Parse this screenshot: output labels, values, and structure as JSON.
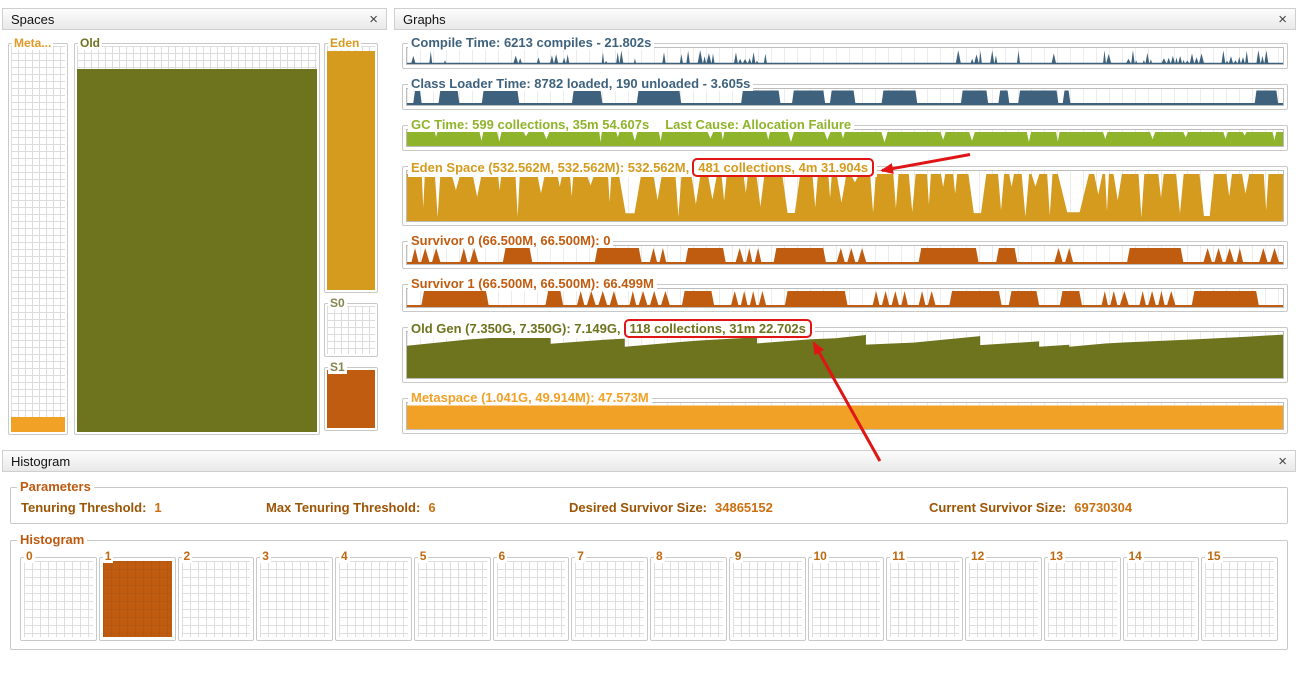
{
  "colors": {
    "annotation_red": "#e01515",
    "olive": "#6e731d",
    "gold": "#d49b1e",
    "survivor_orange": "#c05c10",
    "meta_orange": "#f2a127",
    "blue": "#3e627d",
    "green": "#8fb32a"
  },
  "panels": {
    "spaces": {
      "title": "Spaces",
      "close_label": "×"
    },
    "graphs": {
      "title": "Graphs",
      "close_label": "×"
    },
    "histogram": {
      "title": "Histogram",
      "close_label": "×"
    }
  },
  "spaces": [
    {
      "id": "metaspace",
      "label": "Meta...",
      "title_color": "#df9a28",
      "fill_color": "#f2a127",
      "fill_pct": 4
    },
    {
      "id": "old",
      "label": "Old",
      "title_color": "#6e731d",
      "fill_color": "#6e731d",
      "fill_pct": 94
    },
    {
      "id": "eden",
      "label": "Eden",
      "title_color": "#d49b1e",
      "fill_color": "#d49b1e",
      "fill_pct": 98
    },
    {
      "id": "s0",
      "label": "S0",
      "title_color": "#85854e",
      "fill_color": "#ffffff",
      "fill_pct": 0
    },
    {
      "id": "s1",
      "label": "S1",
      "title_color": "#85854e",
      "fill_color": "#c05c10",
      "fill_pct": 100
    }
  ],
  "graphs": [
    {
      "title": "Compile Time: 6213 compiles - 21.802s",
      "color": "#3e627d",
      "pattern": "spikes",
      "height": 16
    },
    {
      "title": "Class Loader Time: 8782 loaded, 190 unloaded - 3.605s",
      "color": "#3e627d",
      "pattern": "blocks",
      "height": 16
    },
    {
      "title": "GC Time: 599 collections, 35m 54.607s",
      "cause": "Last Cause: Allocation Failure",
      "color": "#8fb32a",
      "pattern": "notched",
      "height": 16
    },
    {
      "title": "Eden Space (532.562M, 532.562M): 532.562M,",
      "boxed": "481 collections, 4m 31.904s",
      "color": "#d49b1e",
      "pattern": "eden",
      "height": 50
    },
    {
      "title": "Survivor 0 (66.500M, 66.500M): 0",
      "color": "#c05c10",
      "pattern": "survivor",
      "height": 18
    },
    {
      "title": "Survivor 1 (66.500M, 66.500M): 66.499M",
      "color": "#c05c10",
      "pattern": "survivor",
      "height": 18
    },
    {
      "title": "Old Gen (7.350G, 7.350G): 7.149G,",
      "boxed": "118 collections, 31m 22.702s",
      "color": "#6e731d",
      "pattern": "oldgen",
      "height": 46
    },
    {
      "title": "Metaspace (1.041G, 49.914M): 47.573M",
      "color": "#f2a127",
      "pattern": "flat",
      "height": 26
    }
  ],
  "histogram": {
    "parameters": {
      "title": "Parameters",
      "items": [
        {
          "label": "Tenuring Threshold:",
          "value": "1"
        },
        {
          "label": "Max Tenuring Threshold:",
          "value": "6"
        },
        {
          "label": "Desired Survivor Size:",
          "value": "34865152"
        },
        {
          "label": "Current Survivor Size:",
          "value": "69730304"
        }
      ]
    },
    "buckets": {
      "title": "Histogram",
      "labels": [
        "0",
        "1",
        "2",
        "3",
        "4",
        "5",
        "6",
        "7",
        "8",
        "9",
        "10",
        "11",
        "12",
        "13",
        "14",
        "15"
      ],
      "filled_index": 1,
      "fill_color": "#c05c10",
      "label_color": "#bf6a12"
    }
  }
}
